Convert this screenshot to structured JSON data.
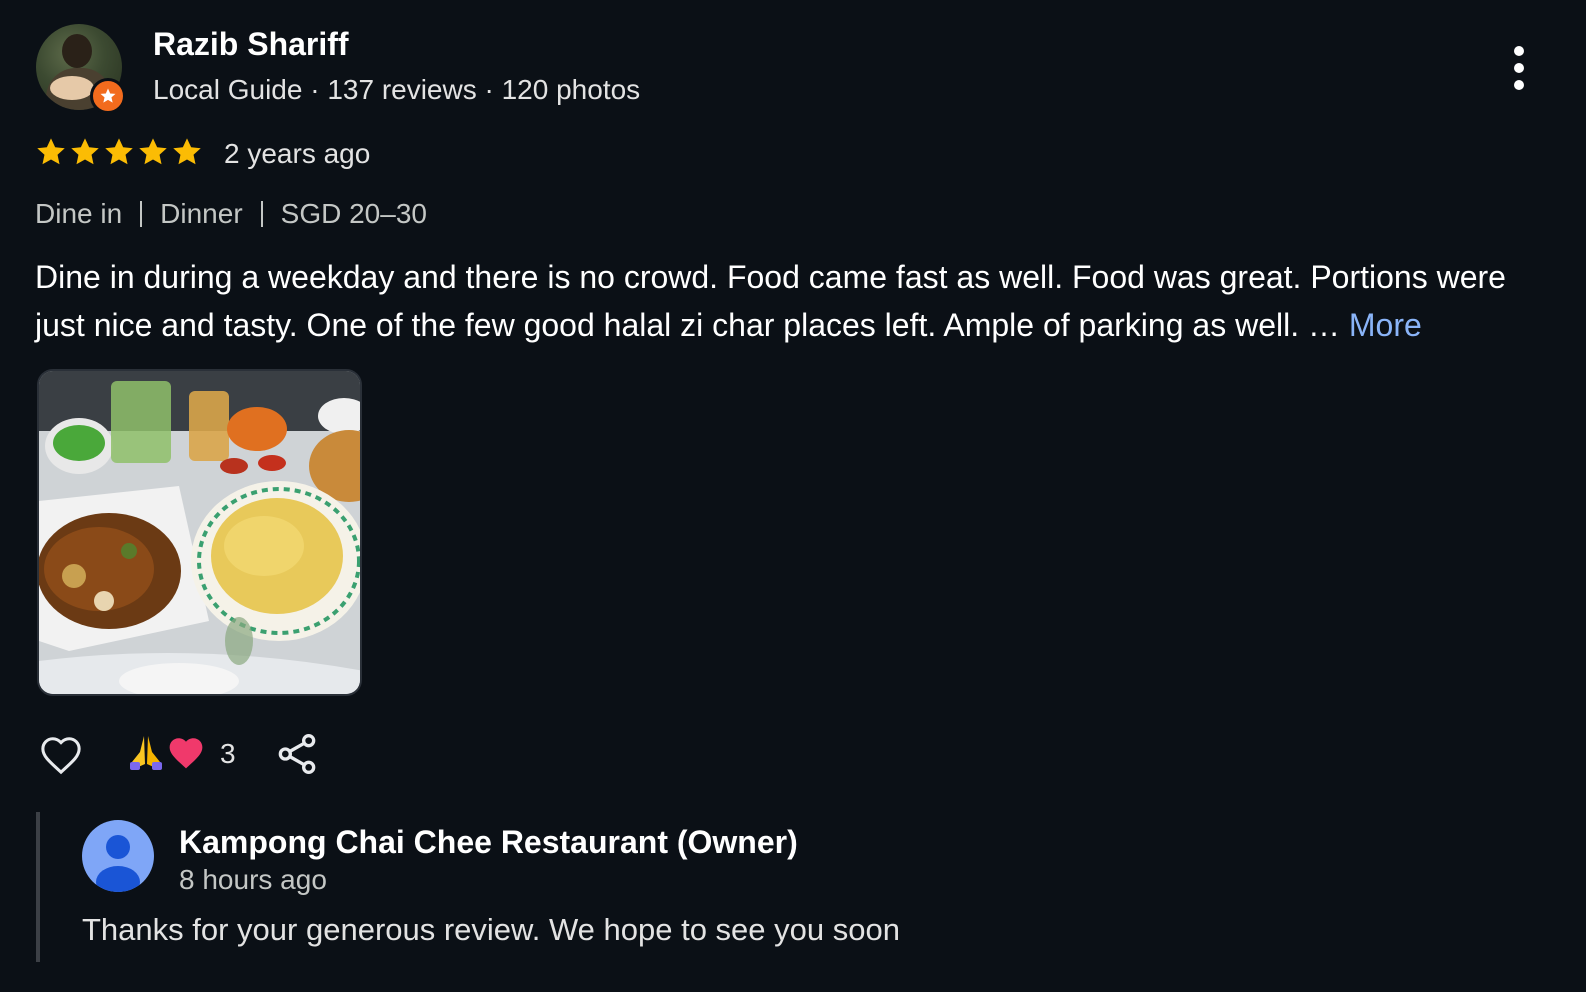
{
  "review": {
    "author": {
      "name": "Razib Shariff",
      "meta": "Local Guide · 137 reviews · 120 photos",
      "badge_icon": "local-guide-star-icon"
    },
    "rating": 5,
    "time": "2 years ago",
    "attributes": [
      "Dine in",
      "Dinner",
      "SGD 20–30"
    ],
    "text": "Dine in during a weekday and there is no crowd. Food came fast as well. Food was great. Portions were just nice and tasty. One of the few good halal zi char places left. Ample of parking as well. … ",
    "more_label": "More",
    "reactions": {
      "emojis": [
        "🙏",
        "❤"
      ],
      "count": "3"
    },
    "icons": {
      "menu": "more-vert-icon",
      "like": "heart-outline-icon",
      "share": "share-icon"
    }
  },
  "owner_response": {
    "name": "Kampong Chai Chee Restaurant (Owner)",
    "time": "8 hours ago",
    "text": "Thanks for your generous review. We hope to see you soon"
  },
  "colors": {
    "background": "#0b1016",
    "star": "#fbbc04",
    "link": "#8ab4f8",
    "badge": "#f26b1d",
    "owner_avatar": "#7fa6f7"
  }
}
